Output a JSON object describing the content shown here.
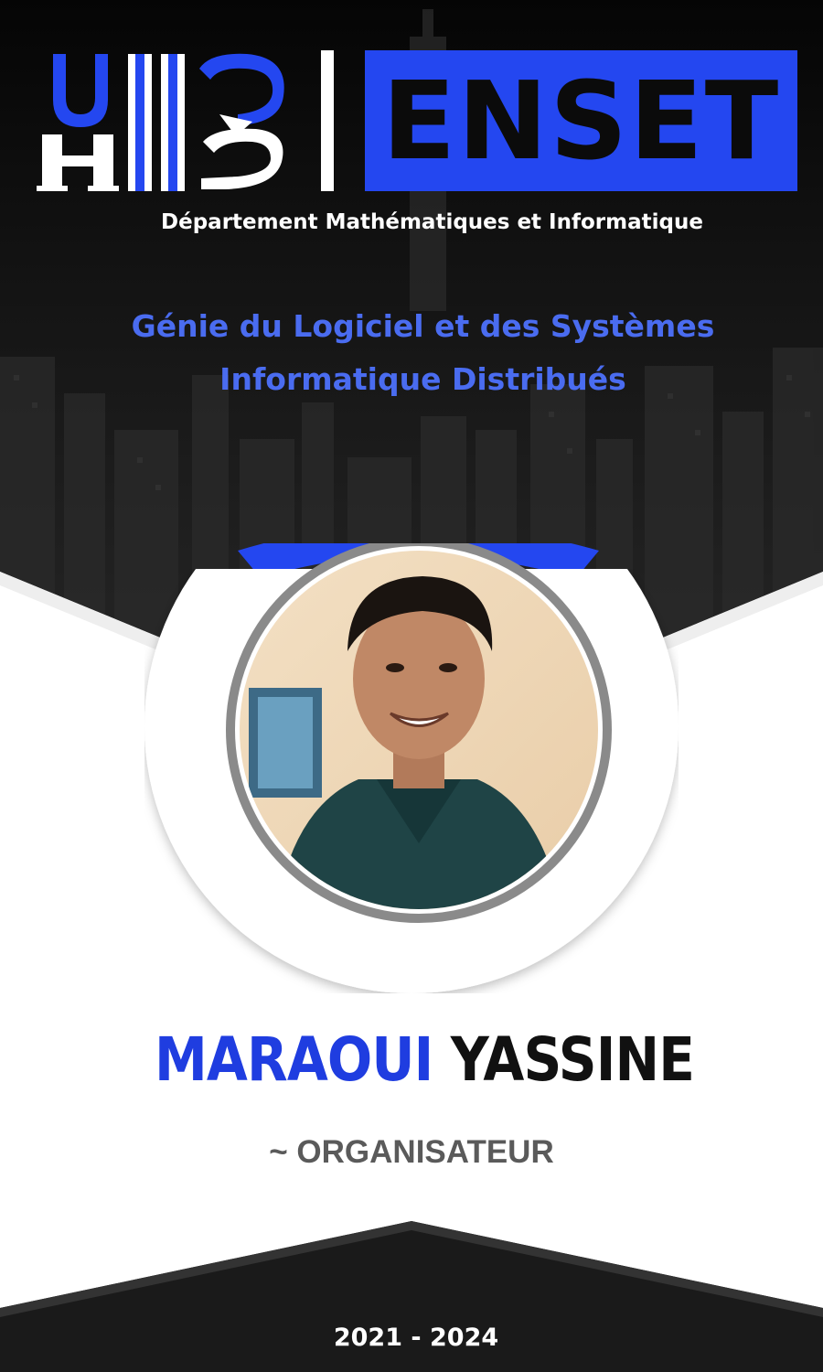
{
  "logos": {
    "university_logo_icon": "uh2-logo-icon",
    "school_name": "ENSET"
  },
  "department": "Département Mathématiques et Informatique",
  "program": {
    "line1": "Génie du Logiciel et des Systèmes",
    "line2": "Informatique Distribués"
  },
  "person": {
    "first_name": "MARAOUI",
    "last_name": "YASSINE",
    "role": "~ ORGANISATEUR",
    "photo_icon": "portrait-photo"
  },
  "years": "2021 - 2024",
  "colors": {
    "accent_blue": "#2447f0",
    "program_blue": "#4a6cf0",
    "dark": "#111111",
    "role_gray": "#5a5a5a"
  }
}
